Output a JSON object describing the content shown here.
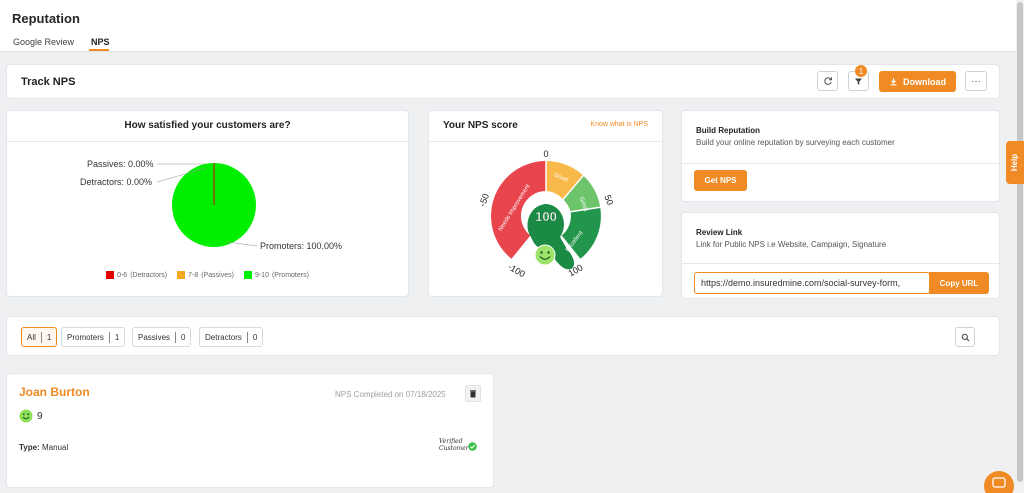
{
  "header": {
    "title": "Reputation",
    "tabs": [
      {
        "label": "Google Review",
        "active": false
      },
      {
        "label": "NPS",
        "active": true
      }
    ]
  },
  "track": {
    "title": "Track NPS",
    "filter_badge": "1",
    "download_label": "Download",
    "more_label": "···"
  },
  "satisfaction": {
    "title": "How satisfied your customers are?",
    "labels": {
      "passives": "Passives: 0.00%",
      "detractors": "Detractors: 0.00%",
      "promoters": "Promoters: 100.00%"
    },
    "legend": [
      {
        "range": "0-6",
        "name": "(Detractors)",
        "color": "#e00000"
      },
      {
        "range": "7-8",
        "name": "(Passives)",
        "color": "#f7a823"
      },
      {
        "range": "9-10",
        "name": "(Promoters)",
        "color": "#00ee00"
      }
    ]
  },
  "chart_data": {
    "type": "pie",
    "title": "How satisfied your customers are?",
    "categories": [
      "Promoters",
      "Passives",
      "Detractors"
    ],
    "values": [
      100.0,
      0.0,
      0.0
    ],
    "colors": [
      "#00ee00",
      "#f7a823",
      "#e00000"
    ]
  },
  "nps": {
    "title": "Your NPS score",
    "link": "Know what is NPS",
    "score": "100",
    "ticks": [
      "0",
      "-50",
      "50",
      "-100",
      "100"
    ],
    "segments": [
      "Needs Improvement",
      "Good",
      "Great",
      "Excellent"
    ],
    "colors": {
      "needs": "#e8454d",
      "good": "#f8b84a",
      "great": "#6cc46b",
      "excellent": "#21964c"
    }
  },
  "build": {
    "title": "Build Reputation",
    "desc": "Build your online reputation by surveying each customer",
    "button": "Get NPS"
  },
  "review": {
    "title": "Review Link",
    "desc": "Link for Public NPS i.e Website, Campaign, Signature",
    "url": "https://demo.insuredmine.com/social-survey-form,",
    "button": "Copy URL"
  },
  "filters": [
    {
      "label": "All",
      "count": "1",
      "active": true
    },
    {
      "label": "Promoters",
      "count": "1",
      "active": false
    },
    {
      "label": "Passives",
      "count": "0",
      "active": false
    },
    {
      "label": "Detractors",
      "count": "0",
      "active": false
    }
  ],
  "response": {
    "name": "Joan Burton",
    "completed": "NPS Completed on 07/18/2025",
    "score": "9",
    "type_label": "Type:",
    "type_value": "Manual",
    "verified_line1": "Verified",
    "verified_line2": "Customer"
  },
  "help": {
    "label": "Help"
  }
}
